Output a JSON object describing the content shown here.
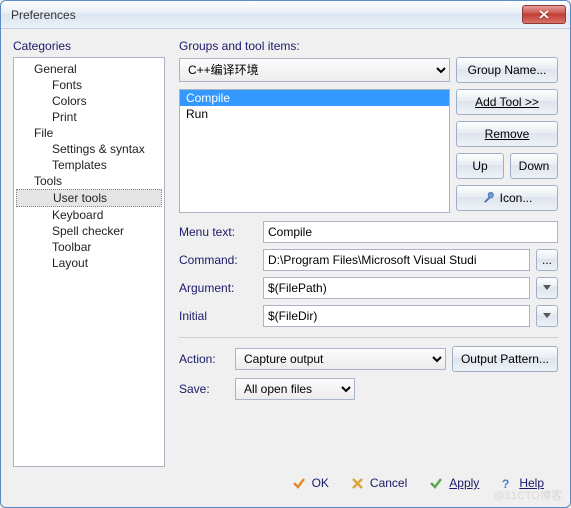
{
  "window": {
    "title": "Preferences"
  },
  "categories": {
    "label": "Categories",
    "tree": [
      {
        "label": "General",
        "children": [
          "Fonts",
          "Colors",
          "Print"
        ]
      },
      {
        "label": "File",
        "children": [
          "Settings & syntax",
          "Templates"
        ]
      },
      {
        "label": "Tools",
        "children": [
          "User tools",
          "Keyboard",
          "Spell checker",
          "Toolbar",
          "Layout"
        ],
        "selected": "User tools"
      }
    ]
  },
  "groups": {
    "label": "Groups and tool items:",
    "dropdown_value": "C++编译环境",
    "group_name_btn": "Group Name...",
    "items": [
      "Compile",
      "Run"
    ],
    "selected_item": "Compile",
    "add_tool_btn": "Add Tool >>",
    "remove_btn": "Remove",
    "up_btn": "Up",
    "down_btn": "Down",
    "icon_btn": "Icon..."
  },
  "fields": {
    "menu_text_label": "Menu text:",
    "menu_text_value": "Compile",
    "command_label": "Command:",
    "command_value": "D:\\Program Files\\Microsoft Visual Studi",
    "argument_label": "Argument:",
    "argument_value": "$(FilePath)",
    "initial_label": "Initial",
    "initial_value": "$(FileDir)",
    "action_label": "Action:",
    "action_value": "Capture output",
    "output_pattern_btn": "Output Pattern...",
    "save_label": "Save:",
    "save_value": "All open files"
  },
  "buttons": {
    "ok": "OK",
    "cancel": "Cancel",
    "apply": "Apply",
    "help": "Help"
  },
  "watermark": "@51CTO博客"
}
